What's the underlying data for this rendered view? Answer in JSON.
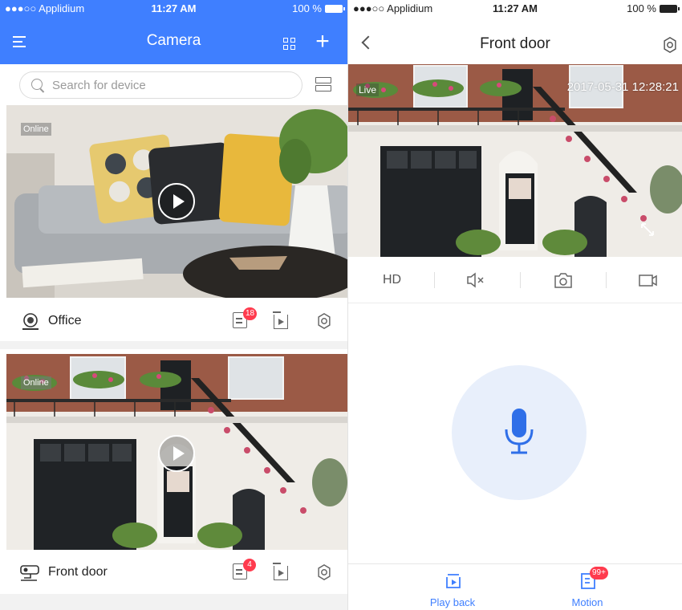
{
  "left": {
    "status": {
      "carrier": "●●●○○ Applidium",
      "time": "11:27 AM",
      "battery": "100 %"
    },
    "nav": {
      "title": "Camera"
    },
    "search": {
      "placeholder": "Search for device"
    },
    "cameras": [
      {
        "name": "Office",
        "status": "Online",
        "notifications": "18"
      },
      {
        "name": "Front door",
        "status": "Online",
        "notifications": "4"
      }
    ]
  },
  "right": {
    "status": {
      "carrier": "●●●○○ Applidium",
      "time": "11:27 AM",
      "battery": "100 %"
    },
    "nav": {
      "title": "Front door"
    },
    "feed": {
      "live_label": "Live",
      "timestamp": "2017-05-31 12:28:21"
    },
    "controls": {
      "hd": "HD"
    },
    "tabs": [
      {
        "label": "Play back",
        "icon": "playback-icon"
      },
      {
        "label": "Motion",
        "icon": "motion-icon",
        "badge": "99+"
      }
    ]
  },
  "colors": {
    "accent": "#3f7fff",
    "badge": "#ff3b4e",
    "mic_circle": "#e8effb",
    "icon_gray": "#666666"
  }
}
